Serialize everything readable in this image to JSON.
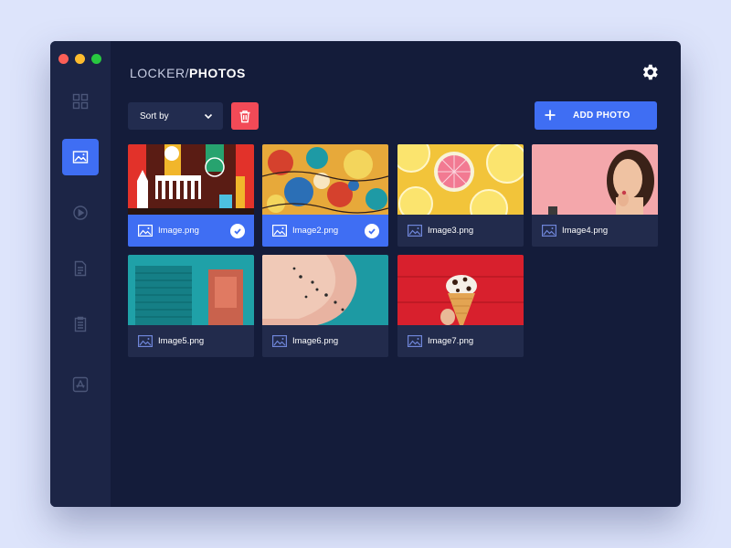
{
  "app": {
    "title_prefix": "LOCKER/",
    "title_main": "PHOTOS"
  },
  "sidebar": {
    "items": [
      {
        "name": "grid",
        "icon": "grid-icon",
        "active": false
      },
      {
        "name": "photos",
        "icon": "image-icon",
        "active": true
      },
      {
        "name": "videos",
        "icon": "play-icon",
        "active": false
      },
      {
        "name": "documents",
        "icon": "document-icon",
        "active": false
      },
      {
        "name": "notes",
        "icon": "clipboard-icon",
        "active": false
      },
      {
        "name": "apps",
        "icon": "app-store-icon",
        "active": false
      }
    ]
  },
  "toolbar": {
    "sort_label": "Sort by",
    "add_label": "ADD PHOTO"
  },
  "photos": [
    {
      "name": "Image.png",
      "selected": true
    },
    {
      "name": "Image2.png",
      "selected": true
    },
    {
      "name": "Image3.png",
      "selected": false
    },
    {
      "name": "Image4.png",
      "selected": false
    },
    {
      "name": "Image5.png",
      "selected": false
    },
    {
      "name": "Image6.png",
      "selected": false
    },
    {
      "name": "Image7.png",
      "selected": false
    }
  ],
  "colors": {
    "accent": "#3f6ef3",
    "danger": "#f24a57",
    "window_bg": "#141c3a",
    "sidebar_bg": "#1c2546",
    "card_bg": "#222b4c",
    "page_bg": "#dde4fb"
  }
}
